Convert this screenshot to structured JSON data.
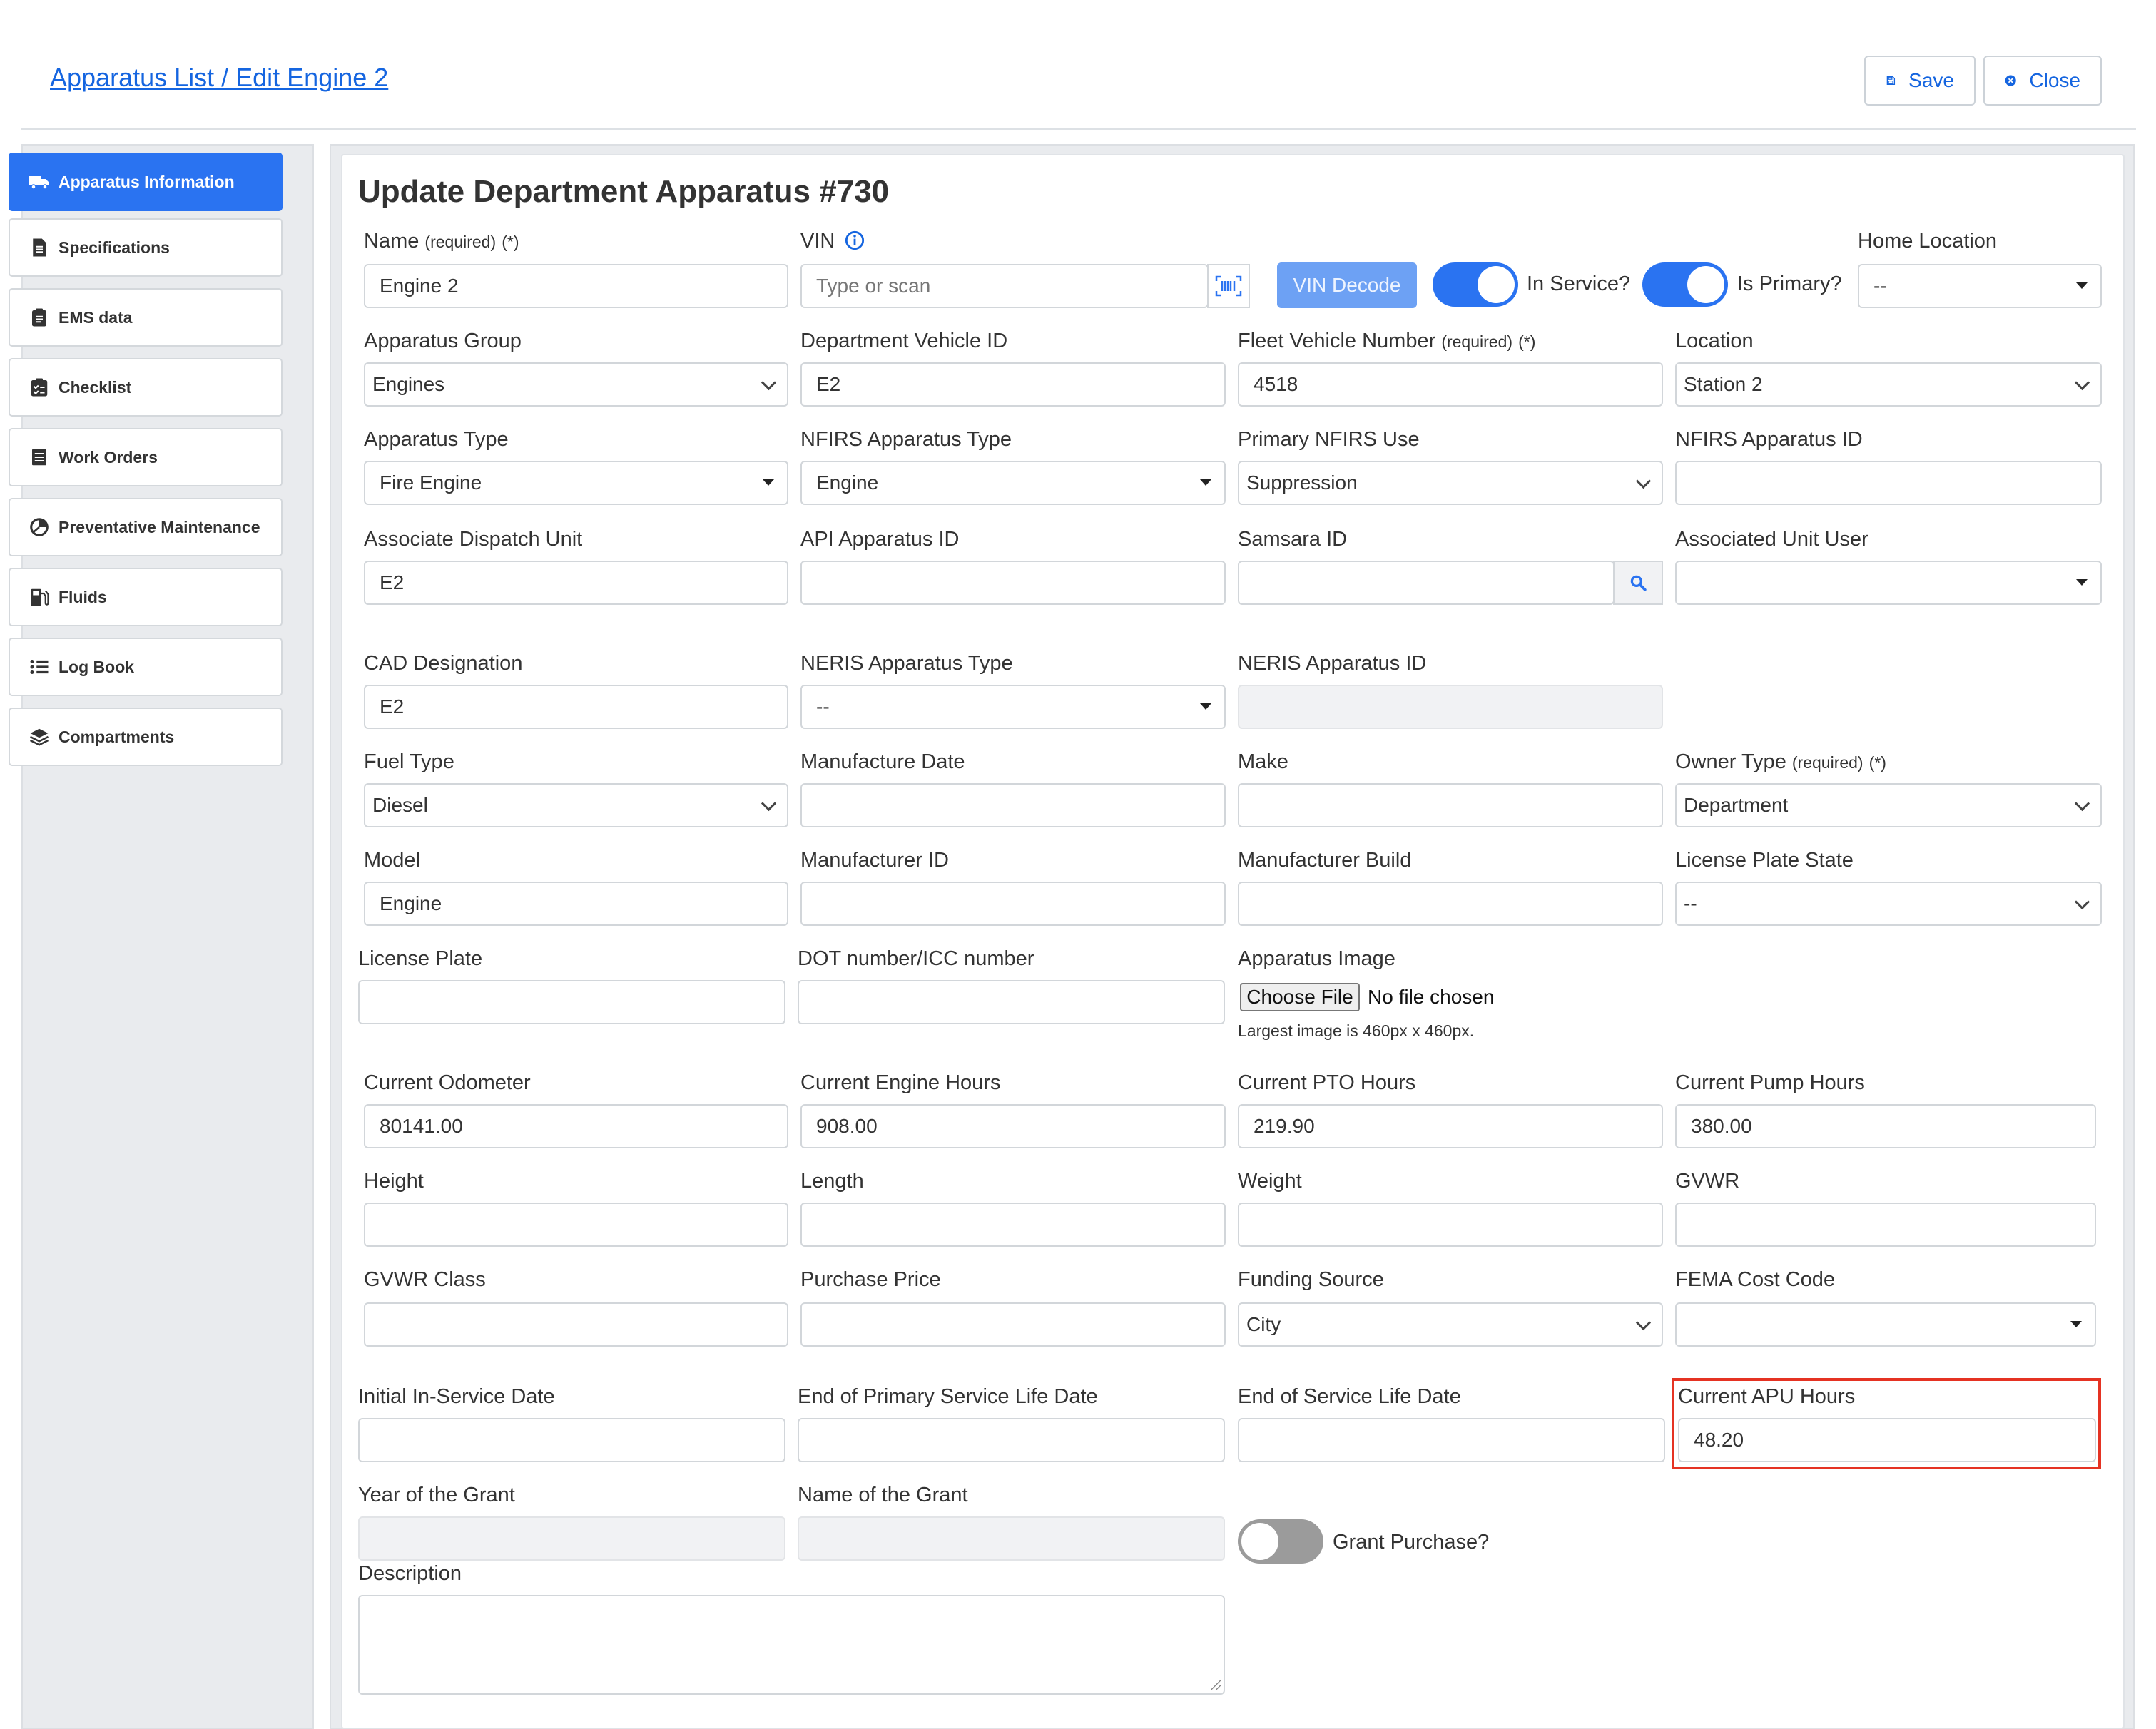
{
  "header": {
    "breadcrumb": "Apparatus List / Edit Engine 2",
    "save_label": "Save",
    "close_label": "Close"
  },
  "sidebar": {
    "items": [
      {
        "label": "Apparatus Information",
        "icon": "truck-icon",
        "active": true
      },
      {
        "label": "Specifications",
        "icon": "document-icon",
        "active": false
      },
      {
        "label": "EMS data",
        "icon": "clipboard-icon",
        "active": false
      },
      {
        "label": "Checklist",
        "icon": "checklist-icon",
        "active": false
      },
      {
        "label": "Work Orders",
        "icon": "list-icon",
        "active": false
      },
      {
        "label": "Preventative Maintenance",
        "icon": "pie-icon",
        "active": false
      },
      {
        "label": "Fluids",
        "icon": "fuel-pump-icon",
        "active": false
      },
      {
        "label": "Log Book",
        "icon": "list-bullets-icon",
        "active": false
      },
      {
        "label": "Compartments",
        "icon": "layers-icon",
        "active": false
      }
    ]
  },
  "form": {
    "title": "Update Department Apparatus #730",
    "required_note": "(required)",
    "required_star": "(*)",
    "name": {
      "label": "Name",
      "value": "Engine 2"
    },
    "vin": {
      "label": "VIN",
      "placeholder": "Type or scan",
      "decode_label": "VIN Decode"
    },
    "in_service": {
      "label": "In Service?",
      "on": true
    },
    "is_primary": {
      "label": "Is Primary?",
      "on": true
    },
    "home_location": {
      "label": "Home Location",
      "value": "--"
    },
    "apparatus_group": {
      "label": "Apparatus Group",
      "value": "Engines"
    },
    "dept_vehicle_id": {
      "label": "Department Vehicle ID",
      "value": "E2"
    },
    "fleet_vehicle_number": {
      "label": "Fleet Vehicle Number",
      "value": "4518"
    },
    "location": {
      "label": "Location",
      "value": "Station 2"
    },
    "apparatus_type": {
      "label": "Apparatus Type",
      "value": "Fire Engine"
    },
    "nfirs_apparatus_type": {
      "label": "NFIRS Apparatus Type",
      "value": "Engine"
    },
    "primary_nfirs_use": {
      "label": "Primary NFIRS Use",
      "value": "Suppression"
    },
    "nfirs_apparatus_id": {
      "label": "NFIRS Apparatus ID",
      "value": ""
    },
    "associate_dispatch_unit": {
      "label": "Associate Dispatch Unit",
      "value": "E2"
    },
    "api_apparatus_id": {
      "label": "API Apparatus ID",
      "value": ""
    },
    "samsara_id": {
      "label": "Samsara ID",
      "value": ""
    },
    "associated_unit_user": {
      "label": "Associated Unit User",
      "value": ""
    },
    "cad_designation": {
      "label": "CAD Designation",
      "value": "E2"
    },
    "neris_apparatus_type": {
      "label": "NERIS Apparatus Type",
      "value": "--"
    },
    "neris_apparatus_id": {
      "label": "NERIS Apparatus ID",
      "value": ""
    },
    "fuel_type": {
      "label": "Fuel Type",
      "value": "Diesel"
    },
    "manufacture_date": {
      "label": "Manufacture Date",
      "value": ""
    },
    "make": {
      "label": "Make",
      "value": ""
    },
    "owner_type": {
      "label": "Owner Type",
      "value": "Department"
    },
    "model": {
      "label": "Model",
      "value": "Engine"
    },
    "manufacturer_id": {
      "label": "Manufacturer ID",
      "value": ""
    },
    "manufacturer_build": {
      "label": "Manufacturer Build",
      "value": ""
    },
    "license_plate_state": {
      "label": "License Plate State",
      "value": "--"
    },
    "license_plate": {
      "label": "License Plate",
      "value": ""
    },
    "dot_number": {
      "label": "DOT number/ICC number",
      "value": ""
    },
    "apparatus_image": {
      "label": "Apparatus Image",
      "button": "Choose File",
      "status": "No file chosen",
      "hint": "Largest image is 460px x 460px."
    },
    "current_odometer": {
      "label": "Current Odometer",
      "value": "80141.00"
    },
    "current_engine_hours": {
      "label": "Current Engine Hours",
      "value": "908.00"
    },
    "current_pto_hours": {
      "label": "Current PTO Hours",
      "value": "219.90"
    },
    "current_pump_hours": {
      "label": "Current Pump Hours",
      "value": "380.00"
    },
    "height": {
      "label": "Height",
      "value": ""
    },
    "length": {
      "label": "Length",
      "value": ""
    },
    "weight": {
      "label": "Weight",
      "value": ""
    },
    "gvwr": {
      "label": "GVWR",
      "value": ""
    },
    "gvwr_class": {
      "label": "GVWR Class",
      "value": ""
    },
    "purchase_price": {
      "label": "Purchase Price",
      "value": ""
    },
    "funding_source": {
      "label": "Funding Source",
      "value": "City"
    },
    "fema_cost_code": {
      "label": "FEMA Cost Code",
      "value": ""
    },
    "initial_in_service_date": {
      "label": "Initial In-Service Date",
      "value": ""
    },
    "end_primary_service_life": {
      "label": "End of Primary Service Life Date",
      "value": ""
    },
    "end_service_life": {
      "label": "End of Service Life Date",
      "value": ""
    },
    "current_apu_hours": {
      "label": "Current APU Hours",
      "value": "48.20"
    },
    "year_of_grant": {
      "label": "Year of the Grant",
      "value": ""
    },
    "name_of_grant": {
      "label": "Name of the Grant",
      "value": ""
    },
    "grant_purchase": {
      "label": "Grant Purchase?",
      "on": false
    },
    "description": {
      "label": "Description",
      "value": ""
    }
  },
  "colors": {
    "accent": "#2a73f1",
    "link": "#1565e0",
    "highlight": "#e53323"
  }
}
